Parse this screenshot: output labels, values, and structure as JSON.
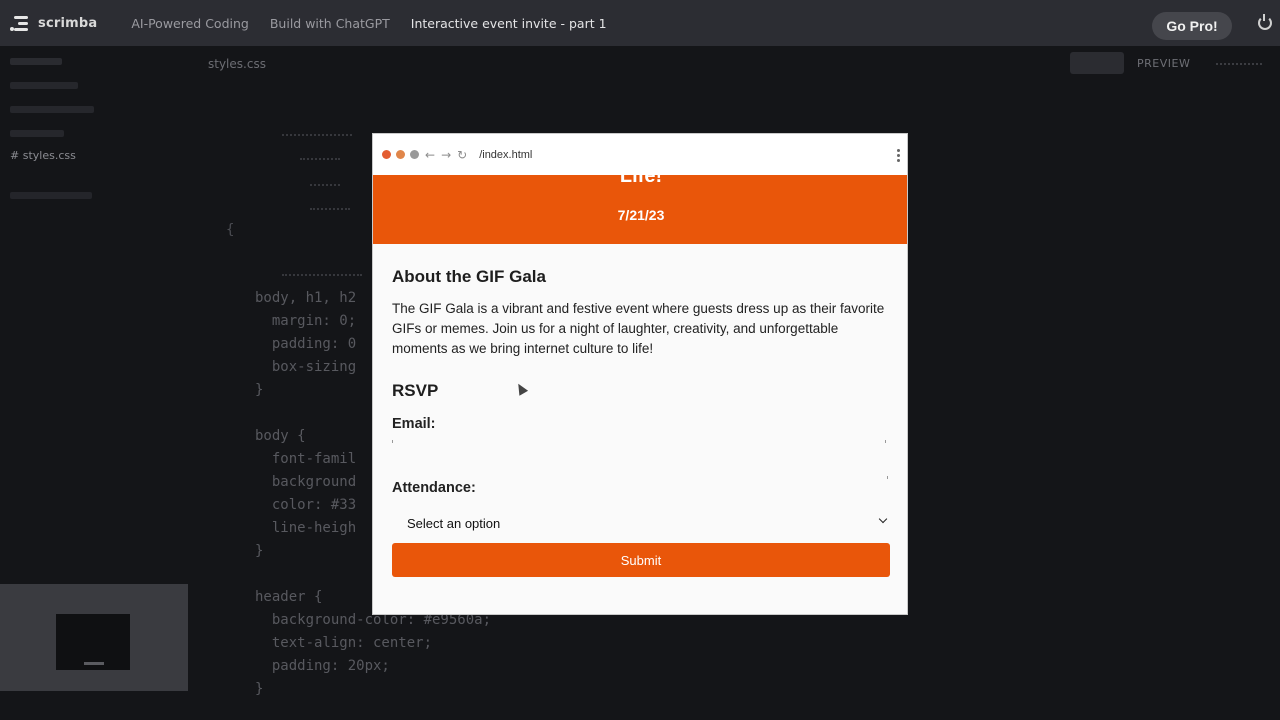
{
  "topbar": {
    "logo_text": "scrimba",
    "breadcrumbs": [
      "AI-Powered Coding",
      "Build with ChatGPT",
      "Interactive event invite - part 1"
    ],
    "cta_label": "Go Pro!"
  },
  "editor": {
    "active_file": "# styles.css",
    "tab_label": "styles.css",
    "preview_label": "PREVIEW",
    "code_lines": [
      "body, h1, h2",
      "  margin: 0;",
      "  padding: 0",
      "  box-sizing",
      "}",
      "body {",
      "  font-famil",
      "  background",
      "  color: #33",
      "  line-heigh",
      "}",
      "header {",
      "  background-color: #e9560a;",
      "  text-align: center;",
      "  padding: 20px;",
      "}"
    ]
  },
  "browser": {
    "url": "/index.html",
    "hero_title": "Life!",
    "hero_date": "7/21/23",
    "about_heading": "About the GIF Gala",
    "about_text": "The GIF Gala is a vibrant and festive event where guests dress up as their favorite GIFs or memes. Join us for a night of laughter, creativity, and unforgettable moments as we bring internet culture to life!",
    "rsvp_heading": "RSVP",
    "email_label": "Email:",
    "attendance_label": "Attendance:",
    "attendance_selected": "Select an option",
    "submit_label": "Submit"
  },
  "colors": {
    "accent": "#e9560a",
    "topbar_bg": "#2c2d33",
    "editor_bg": "#141518"
  }
}
